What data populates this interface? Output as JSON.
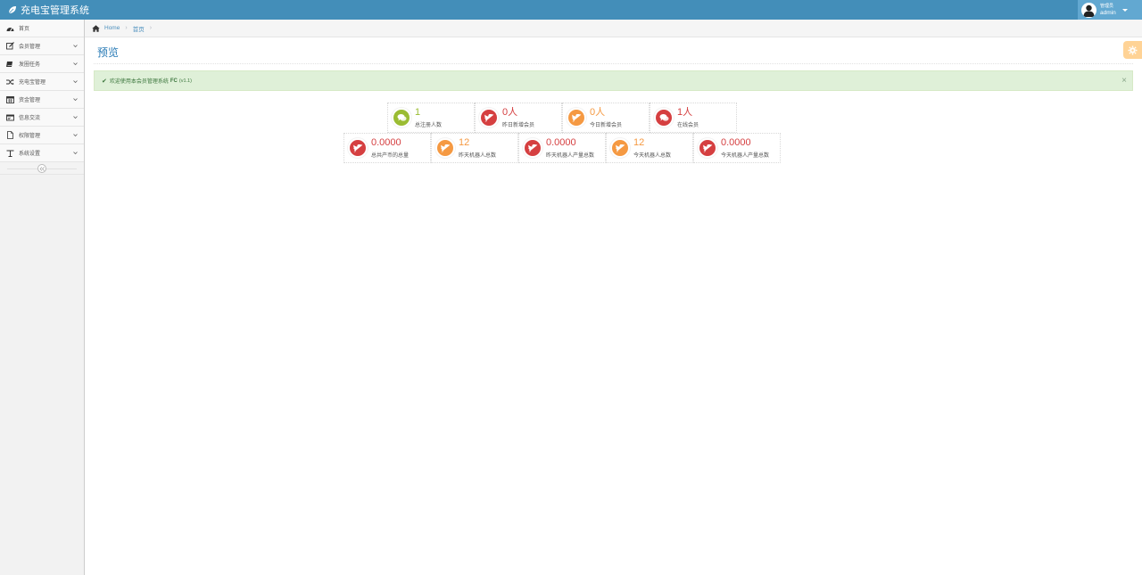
{
  "navbar": {
    "brand": "充电宝管理系统",
    "user_role": "管理员",
    "user_name": "admin"
  },
  "sidebar": {
    "items": [
      {
        "label": "首页",
        "icon": "dashboard-icon"
      },
      {
        "label": "会员管理",
        "icon": "edit-icon"
      },
      {
        "label": "发圈任务",
        "icon": "book-icon"
      },
      {
        "label": "充电宝管理",
        "icon": "random-icon"
      },
      {
        "label": "资金管理",
        "icon": "calendar-icon"
      },
      {
        "label": "信息交流",
        "icon": "card-icon"
      },
      {
        "label": "权限管理",
        "icon": "file-icon"
      },
      {
        "label": "系统设置",
        "icon": "text-height-icon"
      }
    ]
  },
  "breadcrumb": {
    "home": "Home",
    "current": "首页"
  },
  "page": {
    "title": "预览"
  },
  "alert": {
    "text": "欢迎使用本会员管理系统",
    "strong": "FC",
    "version": "(v1.1)",
    "close": "×"
  },
  "stats_row1": [
    {
      "value": "1",
      "label": "总注册人数",
      "color": "#9abc32",
      "icon": "comments-icon"
    },
    {
      "value": "0人",
      "label": "昨日新增会员",
      "color": "#d53f40",
      "icon": "twitter-icon"
    },
    {
      "value": "0人",
      "label": "今日新增会员",
      "color": "#f59942",
      "icon": "twitter-icon"
    },
    {
      "value": "1人",
      "label": "在线会员",
      "color": "#d53f40",
      "icon": "comments-icon"
    }
  ],
  "stats_row2": [
    {
      "value": "0.0000",
      "label": "总共产币的总量",
      "color": "#d53f40",
      "icon": "twitter-icon"
    },
    {
      "value": "12",
      "label": "昨天机器人总数",
      "color": "#f59942",
      "icon": "twitter-icon"
    },
    {
      "value": "0.0000",
      "label": "昨天机器人产量总数",
      "color": "#d53f40",
      "icon": "twitter-icon"
    },
    {
      "value": "12",
      "label": "今天机器人总数",
      "color": "#f59942",
      "icon": "twitter-icon"
    },
    {
      "value": "0.0000",
      "label": "今天机器人产量总数",
      "color": "#d53f40",
      "icon": "twitter-icon"
    }
  ]
}
